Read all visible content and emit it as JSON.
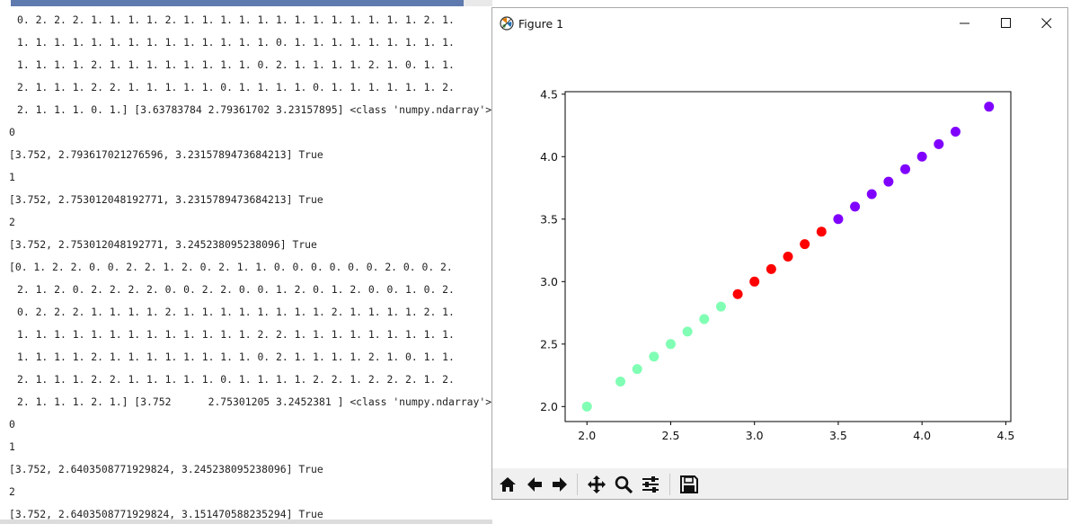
{
  "console": {
    "lines": [
      {
        "text": "0. 2. 2. 2. 1. 1. 1. 1. 2. 1. 1. 1. 1. 1. 1. 1. 1. 1. 1. 1. 1. 1. 2. 1.",
        "style": "indent"
      },
      {
        "text": "1. 1. 1. 1. 1. 1. 1. 1. 1. 1. 1. 1. 1. 1. 0. 1. 1. 1. 1. 1. 1. 1. 1. 1.",
        "style": "indent"
      },
      {
        "text": "1. 1. 1. 1. 2. 1. 1. 1. 1. 1. 1. 1. 1. 0. 2. 1. 1. 1. 1. 2. 1. 0. 1. 1.",
        "style": "indent"
      },
      {
        "text": "2. 1. 1. 1. 2. 2. 1. 1. 1. 1. 1. 0. 1. 1. 1. 1. 0. 1. 1. 1. 1. 1. 1. 2.",
        "style": "indent"
      },
      {
        "text": "2. 1. 1. 1. 0. 1.] [3.63783784 2.79361702 3.23157895] <class 'numpy.ndarray'>",
        "style": "indent"
      },
      {
        "text": "0",
        "style": "flush"
      },
      {
        "text": "[3.752, 2.793617021276596, 3.2315789473684213] True",
        "style": "flush"
      },
      {
        "text": "1",
        "style": "flush"
      },
      {
        "text": "[3.752, 2.753012048192771, 3.2315789473684213] True",
        "style": "flush"
      },
      {
        "text": "2",
        "style": "flush"
      },
      {
        "text": "[3.752, 2.753012048192771, 3.245238095238096] True",
        "style": "flush"
      },
      {
        "text": "[0. 1. 2. 2. 0. 0. 2. 2. 1. 2. 0. 2. 1. 1. 0. 0. 0. 0. 0. 0. 2. 0. 0. 2.",
        "style": "flush"
      },
      {
        "text": "2. 1. 2. 0. 2. 2. 2. 2. 0. 0. 2. 2. 0. 0. 1. 2. 0. 1. 2. 0. 0. 1. 0. 2.",
        "style": "indent"
      },
      {
        "text": "0. 2. 2. 2. 1. 1. 1. 1. 2. 1. 1. 1. 1. 1. 1. 1. 1. 2. 1. 1. 1. 1. 2. 1.",
        "style": "indent"
      },
      {
        "text": "1. 1. 1. 1. 1. 1. 1. 1. 1. 1. 1. 1. 1. 2. 2. 1. 1. 1. 1. 1. 1. 1. 1. 1.",
        "style": "indent"
      },
      {
        "text": "1. 1. 1. 1. 2. 1. 1. 1. 1. 1. 1. 1. 1. 0. 2. 1. 1. 1. 1. 2. 1. 0. 1. 1.",
        "style": "indent"
      },
      {
        "text": "2. 1. 1. 1. 2. 2. 1. 1. 1. 1. 1. 0. 1. 1. 1. 1. 2. 2. 1. 2. 2. 2. 1. 2.",
        "style": "indent"
      },
      {
        "text": "2. 1. 1. 1. 2. 1.] [3.752      2.75301205 3.2452381 ] <class 'numpy.ndarray'>",
        "style": "indent"
      },
      {
        "text": "0",
        "style": "flush"
      },
      {
        "text": "1",
        "style": "flush"
      },
      {
        "text": "[3.752, 2.6403508771929824, 3.245238095238096] True",
        "style": "flush"
      },
      {
        "text": "2",
        "style": "flush"
      },
      {
        "text": "[3.752, 2.6403508771929824, 3.151470588235294] True",
        "style": "flush"
      }
    ]
  },
  "window": {
    "title": "Figure 1",
    "app_icon": "matplotlib-icon",
    "controls": [
      "minimize-icon",
      "maximize-icon",
      "close-icon"
    ]
  },
  "toolbar": {
    "buttons": [
      {
        "name": "home-button",
        "icon": "home-icon"
      },
      {
        "name": "back-button",
        "icon": "back-arrow-icon"
      },
      {
        "name": "forward-button",
        "icon": "forward-arrow-icon"
      },
      {
        "name": "pan-button",
        "icon": "pan-icon"
      },
      {
        "name": "zoom-button",
        "icon": "zoom-icon"
      },
      {
        "name": "configure-subplots-button",
        "icon": "sliders-icon"
      },
      {
        "name": "save-button",
        "icon": "save-icon"
      }
    ]
  },
  "chart_data": {
    "type": "scatter",
    "title": "",
    "xlabel": "",
    "ylabel": "",
    "xlim": [
      1.87,
      4.53
    ],
    "ylim": [
      1.88,
      4.52
    ],
    "xticks": [
      "2.0",
      "2.5",
      "3.0",
      "3.5",
      "4.0",
      "4.5"
    ],
    "yticks": [
      "2.0",
      "2.5",
      "3.0",
      "3.5",
      "4.0",
      "4.5"
    ],
    "grid": false,
    "series": [
      {
        "color": "#80ffb4",
        "x": [
          2.0,
          2.2,
          2.3,
          2.4,
          2.5,
          2.6,
          2.7,
          2.8
        ],
        "y": [
          2.0,
          2.2,
          2.3,
          2.4,
          2.5,
          2.6,
          2.7,
          2.8
        ]
      },
      {
        "color": "#ff0000",
        "x": [
          2.9,
          3.0,
          3.1,
          3.2,
          3.3,
          3.4
        ],
        "y": [
          2.9,
          3.0,
          3.1,
          3.2,
          3.3,
          3.4
        ]
      },
      {
        "color": "#8000ff",
        "x": [
          3.5,
          3.6,
          3.7,
          3.8,
          3.9,
          4.0,
          4.1,
          4.2,
          4.4
        ],
        "y": [
          3.5,
          3.6,
          3.7,
          3.8,
          3.9,
          4.0,
          4.1,
          4.2,
          4.4
        ]
      }
    ]
  }
}
